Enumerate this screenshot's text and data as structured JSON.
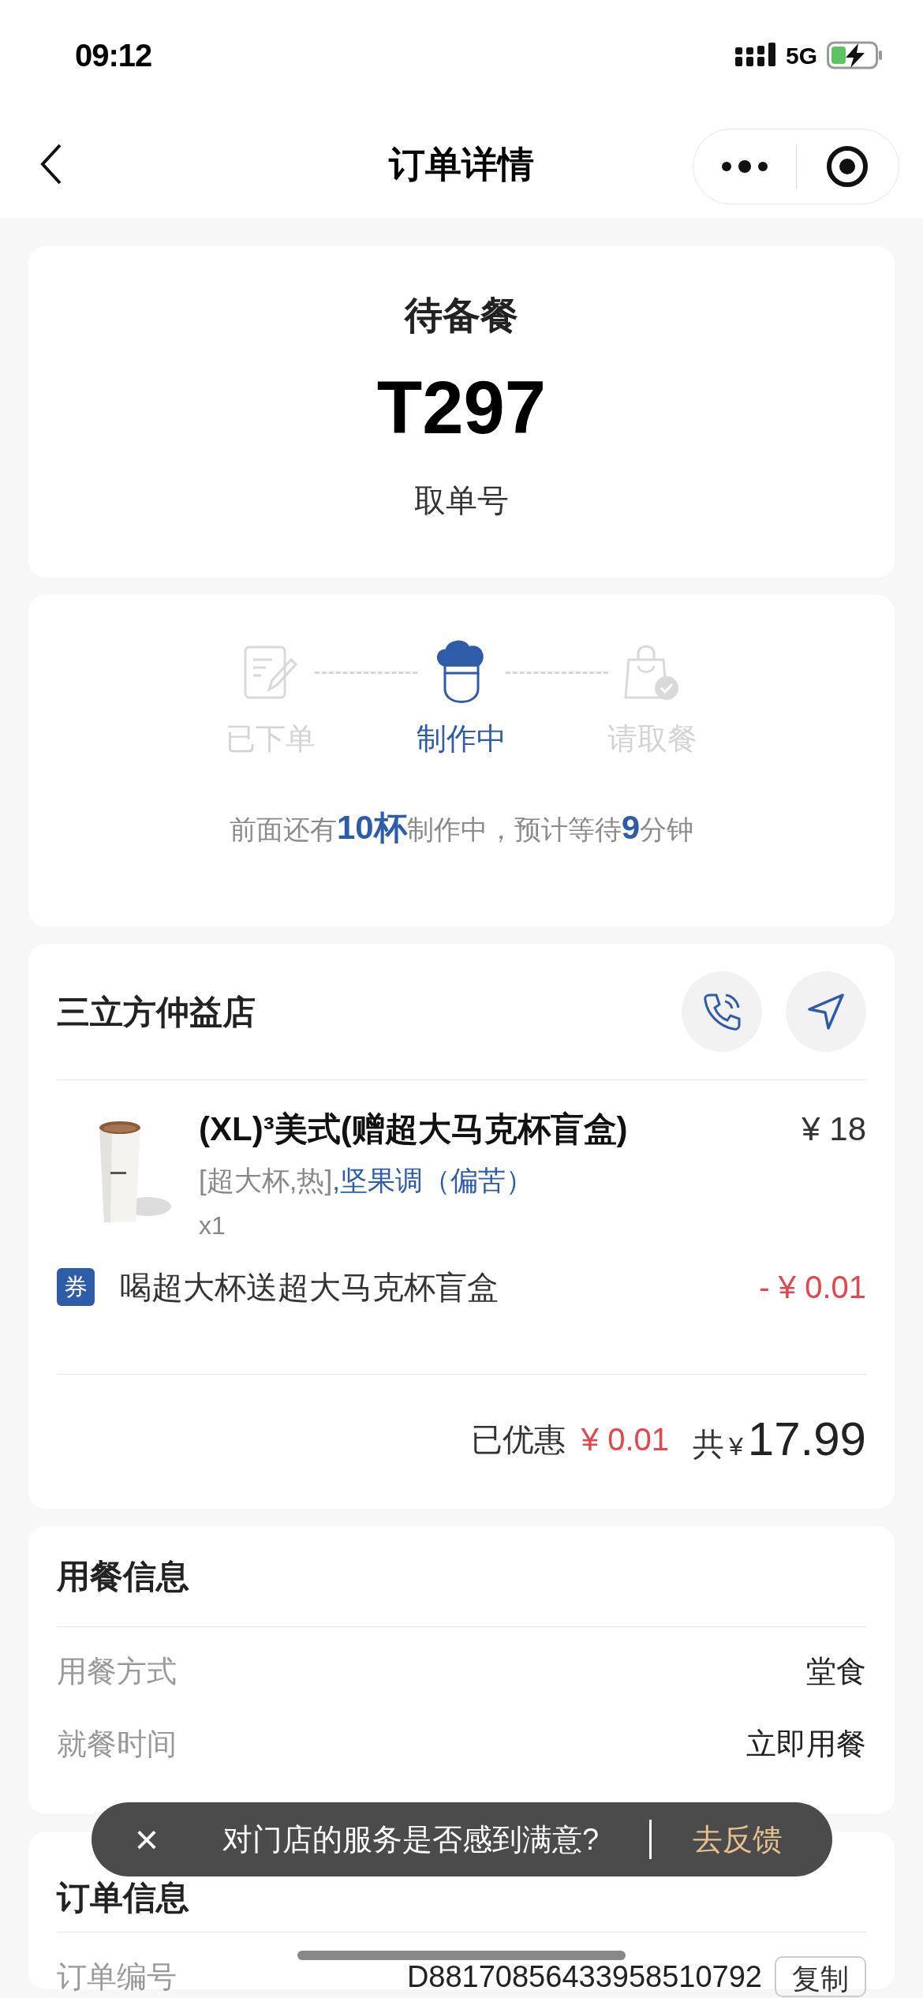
{
  "status_bar": {
    "time": "09:12",
    "network": "5G"
  },
  "nav": {
    "title": "订单详情"
  },
  "order_status": {
    "status": "待备餐",
    "pickup_code": "T297",
    "pickup_label": "取单号"
  },
  "progress": {
    "steps": [
      {
        "kind": "ordered",
        "label": "已下单",
        "selected": false
      },
      {
        "kind": "making",
        "label": "制作中",
        "selected": true
      },
      {
        "kind": "pickup",
        "label": "请取餐",
        "selected": false
      }
    ],
    "note": "前面还有**10杯**制作中，预计等待**9**分钟"
  },
  "store": {
    "name": "三立方仲益店",
    "item": {
      "kind": "picture",
      "name": "(XL)³美式(赠超大马克杯盲盒)",
      "price": "¥ 18",
      "options": "[超大杯,热]",
      "flavor": ",坚果调（偏苦）",
      "quantity": "x1"
    },
    "coupon": {
      "tag": "券",
      "name": "喝超大杯送超大马克杯盲盒",
      "amount": "- ¥ 0.01"
    },
    "discount_label": "已优惠",
    "discount": "¥ 0.01",
    "total_label": "共",
    "total_currency": "¥",
    "total": "17.99"
  },
  "dining_info": {
    "title": "用餐信息",
    "rows": [
      {
        "label": "用餐方式",
        "value": "堂食"
      },
      {
        "label": "就餐时间",
        "value": "立即用餐"
      }
    ]
  },
  "order_info": {
    "title": "订单信息",
    "rows": [
      {
        "label": "订单编号",
        "value": "D88170856433958510792",
        "action": "复制"
      }
    ]
  },
  "toast": {
    "close": "×",
    "message": "对门店的服务是否感到满意?",
    "action": "去反馈"
  }
}
